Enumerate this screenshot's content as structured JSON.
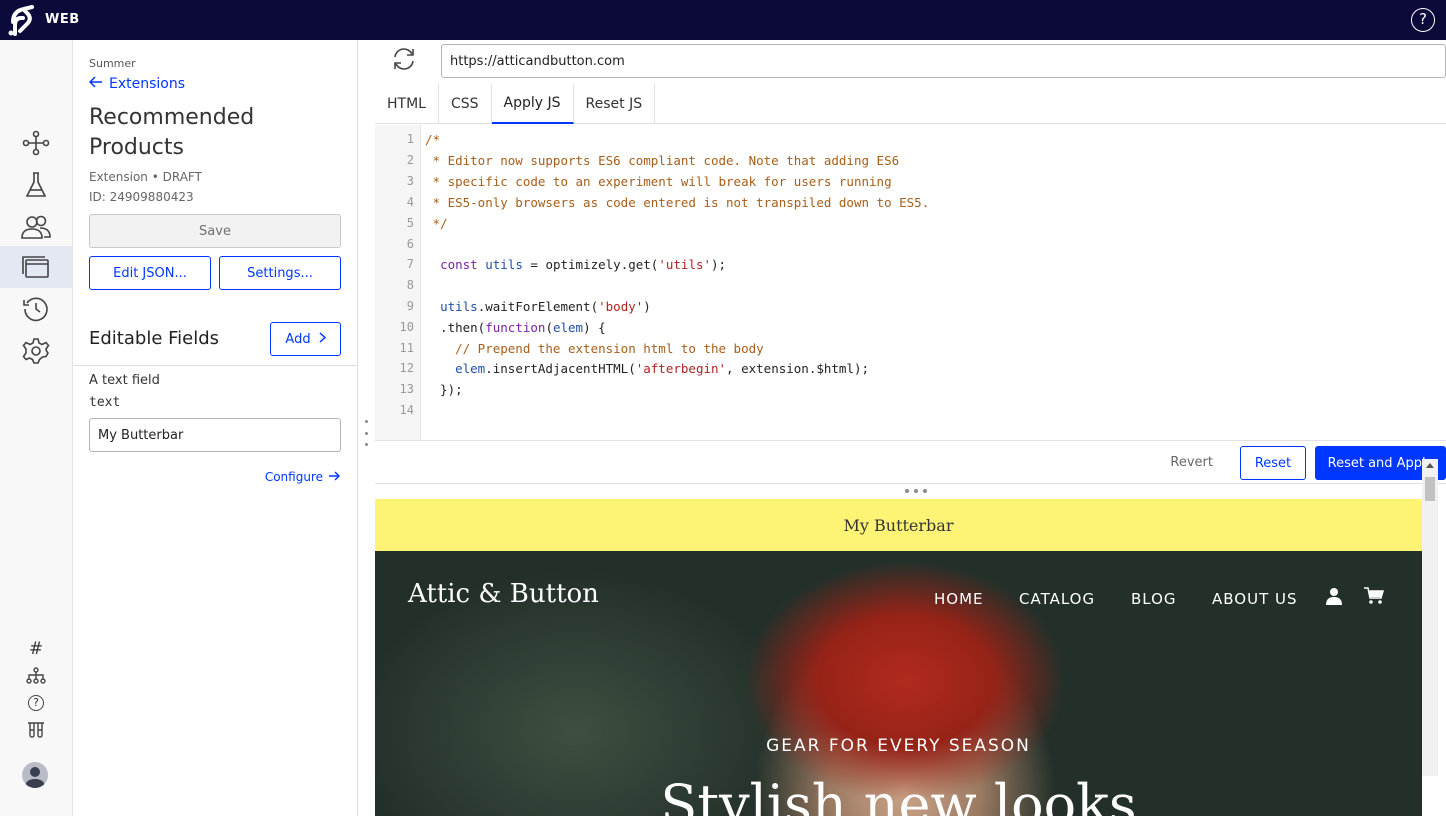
{
  "topbar": {
    "brand": "WEB",
    "help_icon": "question-circle-icon"
  },
  "rail": {
    "icons": [
      "branch-icon",
      "flask-icon",
      "users-icon",
      "extensions-icon",
      "history-icon",
      "gear-icon"
    ],
    "bottom_icons": [
      "hash-icon",
      "hierarchy-icon",
      "help-icon",
      "beakers-icon"
    ],
    "active": "extensions-icon"
  },
  "panel": {
    "project": "Summer",
    "back_label": "Extensions",
    "title": "Recommended Products",
    "meta": "Extension • DRAFT",
    "id": "ID: 24909880423",
    "save_label": "Save",
    "edit_json_label": "Edit JSON...",
    "settings_label": "Settings...",
    "section_title": "Editable Fields",
    "add_label": "Add",
    "field": {
      "label": "A text field",
      "type": "text",
      "value": "My Butterbar"
    },
    "configure_label": "Configure"
  },
  "editor": {
    "url": "https://atticandbutton.com",
    "tabs": [
      "HTML",
      "CSS",
      "Apply JS",
      "Reset JS"
    ],
    "active_tab": "Apply JS",
    "line_numbers": [
      "1",
      "2",
      "3",
      "4",
      "5",
      "6",
      "7",
      "8",
      "9",
      "10",
      "11",
      "12",
      "13",
      "14"
    ],
    "code_lines": [
      "/*",
      " * Editor now supports ES6 compliant code. Note that adding ES6",
      " * specific code to an experiment will break for users running",
      " * ES5-only browsers as code entered is not transpiled down to ES5.",
      " */",
      "",
      "  const utils = optimizely.get('utils');",
      "",
      "  utils.waitForElement('body')",
      "  .then(function(elem) {",
      "    // Prepend the extension html to the body",
      "    elem.insertAdjacentHTML('afterbegin', extension.$html);",
      "  });",
      ""
    ],
    "revert_label": "Revert",
    "reset_label": "Reset",
    "reset_apply_label": "Reset and Apply"
  },
  "preview": {
    "butterbar": "My Butterbar",
    "logo_text": "Attic & Button",
    "nav": [
      "HOME",
      "CATALOG",
      "BLOG",
      "ABOUT US"
    ],
    "tagline": "GEAR FOR EVERY SEASON",
    "headline": "Stylish new looks"
  },
  "colors": {
    "topbar": "#0b0a3a",
    "accent": "#0037ff",
    "butterbar": "#fdf475"
  }
}
